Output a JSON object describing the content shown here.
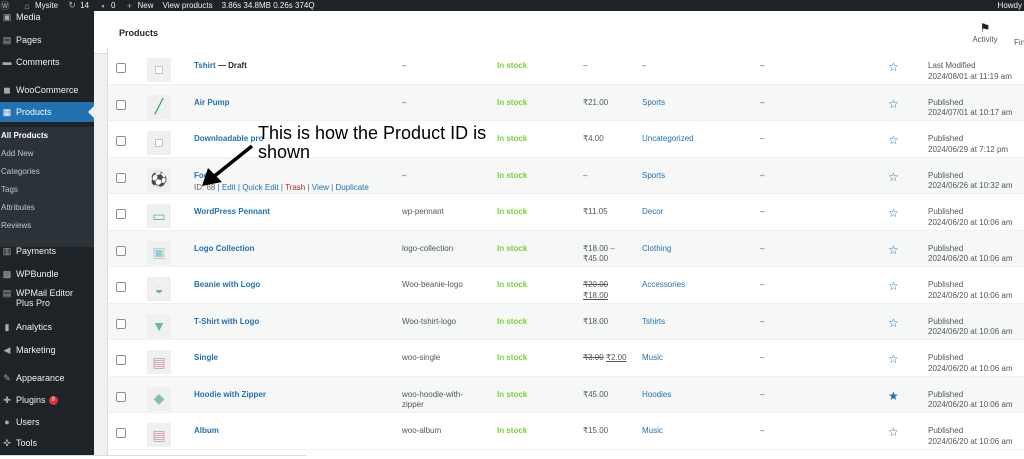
{
  "adminbar": {
    "site": "Mysite",
    "updates": "14",
    "comments": "0",
    "new": "New",
    "view": "View products",
    "perf": "3.86s  34.8MB  0.26s  374Q",
    "howdy": "Howdy"
  },
  "sidebar": {
    "items": [
      {
        "label": "Media",
        "icon": "media-icon"
      },
      {
        "label": "Pages",
        "icon": "pages-icon"
      },
      {
        "label": "Comments",
        "icon": "comments-icon"
      },
      {
        "label": "WooCommerce",
        "icon": "woocommerce-icon"
      },
      {
        "label": "Products",
        "icon": "products-icon"
      },
      {
        "label": "Payments",
        "icon": "payments-icon"
      },
      {
        "label": "WPBundle",
        "icon": "wpbundle-icon"
      },
      {
        "label": "WPMail Editor",
        "label2": "Plus Pro",
        "icon": "wpmail-icon"
      },
      {
        "label": "Analytics",
        "icon": "analytics-icon"
      },
      {
        "label": "Marketing",
        "icon": "marketing-icon"
      },
      {
        "label": "Appearance",
        "icon": "appearance-icon"
      },
      {
        "label": "Plugins",
        "icon": "plugins-icon",
        "badge": "9"
      },
      {
        "label": "Users",
        "icon": "users-icon"
      },
      {
        "label": "Tools",
        "icon": "tools-icon"
      }
    ],
    "submenu": [
      "All Products",
      "Add New",
      "Categories",
      "Tags",
      "Attributes",
      "Reviews"
    ]
  },
  "header": {
    "title": "Products",
    "activity": "Activity",
    "finish": "Fin"
  },
  "rows": [
    {
      "name": "Tshirt",
      "suffix": " — Draft",
      "sku": "–",
      "stock": "In stock",
      "price": "–",
      "cat": "–",
      "tags": "–",
      "status": "Last Modified",
      "date": "2024/08/01 at 11:19 am",
      "thumb": "placeholder"
    },
    {
      "name": "Air Pump",
      "sku": "–",
      "stock": "In stock",
      "price": "₹21.00",
      "cat": "Sports",
      "tags": "–",
      "status": "Published",
      "date": "2024/07/01 at 10:17 am",
      "thumb": "pump"
    },
    {
      "name": "Downloadable pro",
      "sku": "–",
      "stock": "In stock",
      "price": "₹4.00",
      "cat": "Uncategorized",
      "tags": "–",
      "status": "Published",
      "date": "2024/06/29 at 7:12 pm",
      "thumb": "placeholder"
    },
    {
      "name": "Foo",
      "sku": "–",
      "stock": "In stock",
      "price": "–",
      "cat": "Sports",
      "tags": "–",
      "status": "Published",
      "date": "2024/06/26 at 10:32 am",
      "thumb": "ball",
      "actions": {
        "id": "ID: 68",
        "edit": "Edit",
        "quick": "Quick Edit",
        "trash": "Trash",
        "view": "View",
        "dup": "Duplicate"
      }
    },
    {
      "name": "WordPress Pennant",
      "sku": "wp-pennant",
      "stock": "In stock",
      "price": "₹11.05",
      "cat": "Decor",
      "tags": "–",
      "status": "Published",
      "date": "2024/06/20 at 10:06 am",
      "thumb": "pennant"
    },
    {
      "name": "Logo Collection",
      "sku": "logo-collection",
      "stock": "In stock",
      "price": "₹18.00 –",
      "price2": "₹45.00",
      "cat": "Clothing",
      "tags": "–",
      "status": "Published",
      "date": "2024/06/20 at 10:06 am",
      "thumb": "clothes"
    },
    {
      "name": "Beanie with Logo",
      "sku": "Woo-beanie-logo",
      "stock": "In stock",
      "price_old": "₹20.00",
      "price2": "₹18.00",
      "cat": "Accessories",
      "tags": "–",
      "status": "Published",
      "date": "2024/06/20 at 10:06 am",
      "thumb": "beanie"
    },
    {
      "name": "T-Shirt with Logo",
      "sku": "Woo-tshirt-logo",
      "stock": "In stock",
      "price": "₹18.00",
      "cat": "Tshirts",
      "tags": "–",
      "status": "Published",
      "date": "2024/06/20 at 10:06 am",
      "thumb": "tshirt"
    },
    {
      "name": "Single",
      "sku": "woo-single",
      "stock": "In stock",
      "price_old": "₹3.00",
      "price_new": "₹2.00",
      "cat": "Music",
      "tags": "–",
      "status": "Published",
      "date": "2024/06/20 at 10:06 am",
      "thumb": "music"
    },
    {
      "name": "Hoodie with Zipper",
      "sku": "woo-hoodie-with-",
      "sku2": "zipper",
      "stock": "In stock",
      "price": "₹45.00",
      "cat": "Hoodies",
      "tags": "–",
      "status": "Published",
      "date": "2024/06/20 at 10:06 am",
      "thumb": "hoodie",
      "featured": true
    },
    {
      "name": "Album",
      "sku": "woo-album",
      "stock": "In stock",
      "price": "₹15.00",
      "cat": "Music",
      "tags": "–",
      "status": "Published",
      "date": "2024/06/20 at 10:06 am",
      "thumb": "music"
    }
  ],
  "annotation": {
    "line1": "This is how the Product ID is",
    "line2": "shown"
  },
  "colors": {
    "accent": "#2271b1",
    "stock": "#7ad03a",
    "sidebar": "#1d2327"
  }
}
